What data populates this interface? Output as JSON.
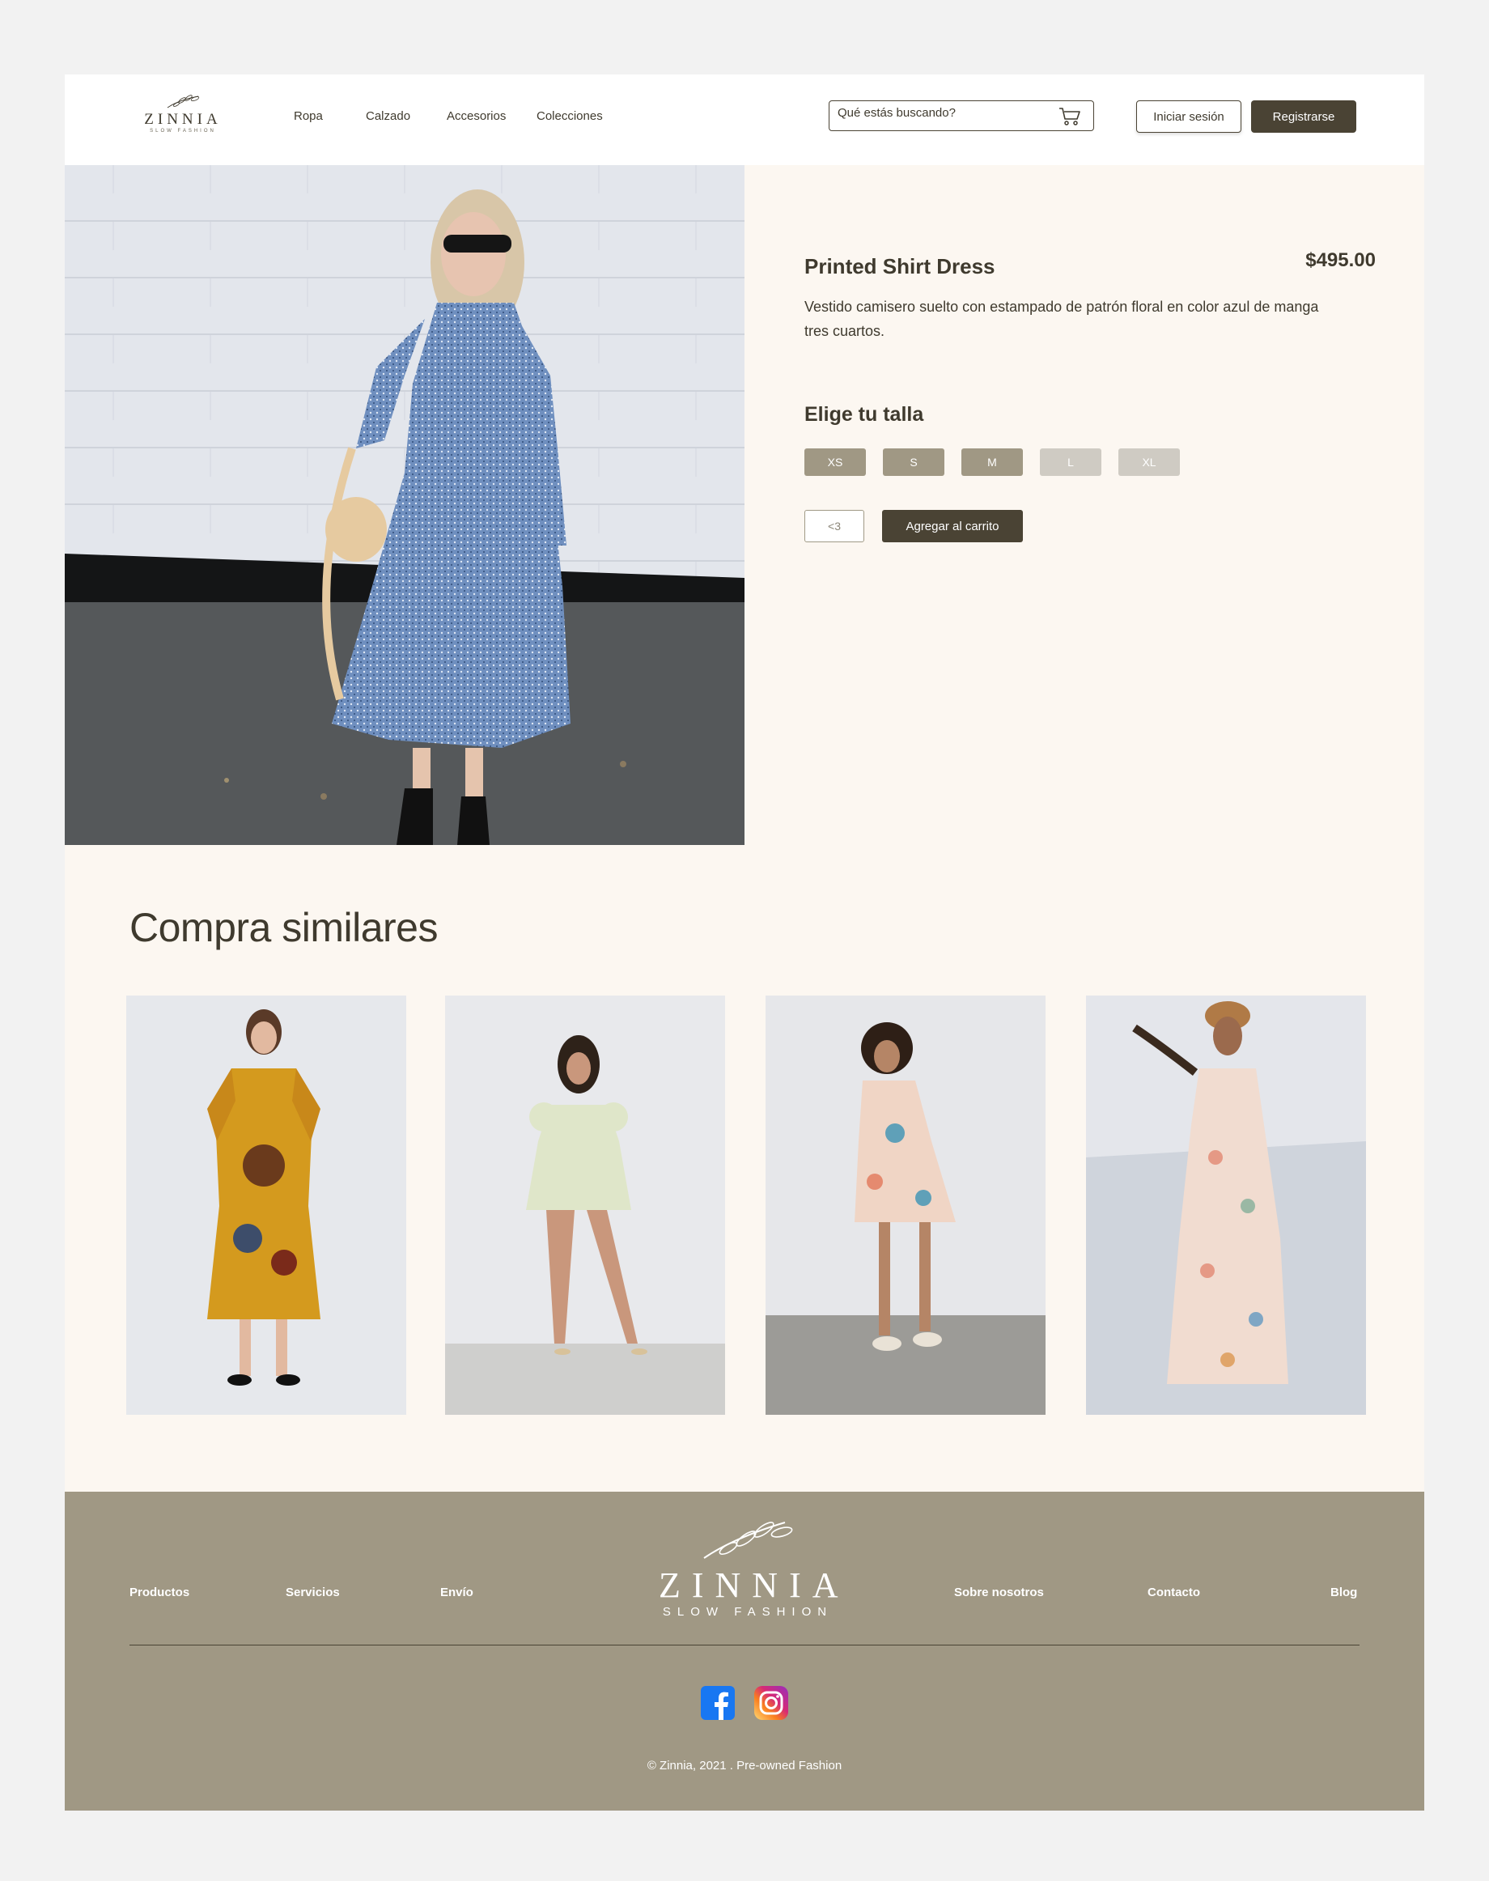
{
  "header": {
    "brand": "ZINNIA",
    "tagline": "SLOW FASHION",
    "nav": [
      "Ropa",
      "Calzado",
      "Accesorios",
      "Colecciones"
    ],
    "search_placeholder": "Qué estás buscando?",
    "login_label": "Iniciar sesión",
    "register_label": "Registrarse"
  },
  "product": {
    "title": "Printed Shirt Dress",
    "price": "$495.00",
    "description": "Vestido camisero suelto con estampado de patrón floral en color azul de manga tres cuartos.",
    "size_heading": "Elige tu talla",
    "sizes": [
      {
        "label": "XS",
        "available": true
      },
      {
        "label": "S",
        "available": true
      },
      {
        "label": "M",
        "available": true
      },
      {
        "label": "L",
        "available": false
      },
      {
        "label": "XL",
        "available": false
      }
    ],
    "favorite_label": "<3",
    "add_to_cart_label": "Agregar al carrito"
  },
  "similar": {
    "heading": "Compra similares"
  },
  "footer": {
    "links_left": [
      "Productos",
      "Servicios",
      "Envío"
    ],
    "links_right": [
      "Sobre nosotros",
      "Contacto",
      "Blog"
    ],
    "brand": "ZINNIA",
    "tagline": "SLOW FASHION",
    "copyright": "©  Zinnia, 2021 . Pre-owned Fashion"
  },
  "colors": {
    "primary": "#4a4334",
    "size_available": "#a09884",
    "size_unavailable": "#cfcbc3",
    "footer_bg": "#a09884",
    "page_bg": "#fcf7f1"
  }
}
